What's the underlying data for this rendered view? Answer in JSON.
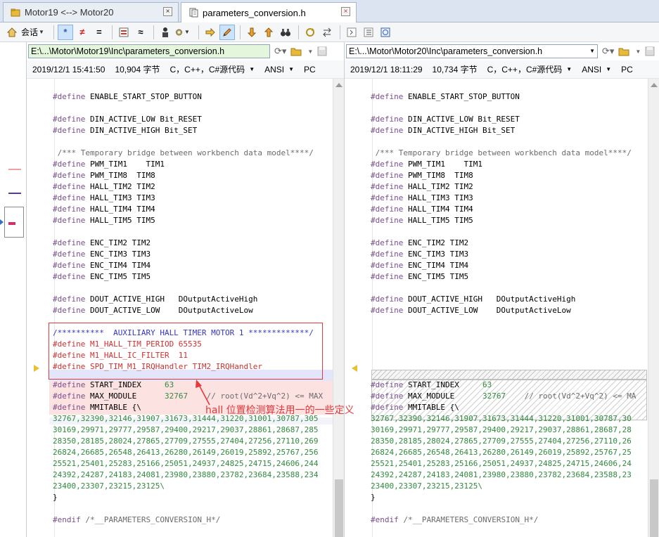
{
  "tabs": [
    {
      "label": "Motor19 <--> Motor20",
      "close": "×"
    },
    {
      "label": "parameters_conversion.h",
      "close": "×"
    }
  ],
  "toolbar": {
    "session_label": "会话"
  },
  "left": {
    "path": "E:\\...\\Motor\\Motor19\\Inc\\parameters_conversion.h",
    "date": "2019/12/1 15:41:50",
    "size": "10,904 字节",
    "lang": "C，C++，C#源代码",
    "encoding": "ANSI",
    "eol": "PC"
  },
  "right": {
    "path": "E:\\...\\Motor\\Motor20\\Inc\\parameters_conversion.h",
    "date": "2019/12/1 18:11:29",
    "size": "10,734 字节",
    "lang": "C，C++，C#源代码",
    "encoding": "ANSI",
    "eol": "PC"
  },
  "code_left": [
    {
      "kw": "#define",
      "rest": " ENABLE_START_STOP_BUTTON"
    },
    {
      "kw": "",
      "rest": ""
    },
    {
      "kw": "#define",
      "rest": " DIN_ACTIVE_LOW Bit_RESET"
    },
    {
      "kw": "#define",
      "rest": " DIN_ACTIVE_HIGH Bit_SET"
    },
    {
      "kw": "",
      "rest": ""
    },
    {
      "kw": "",
      "rest": "",
      "comment": " /*** Temporary bridge between workbench data model****/"
    },
    {
      "kw": "#define",
      "rest": " PWM_TIM1    TIM1"
    },
    {
      "kw": "#define",
      "rest": " PWM_TIM8  TIM8"
    },
    {
      "kw": "#define",
      "rest": " HALL_TIM2 TIM2"
    },
    {
      "kw": "#define",
      "rest": " HALL_TIM3 TIM3"
    },
    {
      "kw": "#define",
      "rest": " HALL_TIM4 TIM4"
    },
    {
      "kw": "#define",
      "rest": " HALL_TIM5 TIM5"
    },
    {
      "kw": "",
      "rest": ""
    },
    {
      "kw": "#define",
      "rest": " ENC_TIM2 TIM2"
    },
    {
      "kw": "#define",
      "rest": " ENC_TIM3 TIM3"
    },
    {
      "kw": "#define",
      "rest": " ENC_TIM4 TIM4"
    },
    {
      "kw": "#define",
      "rest": " ENC_TIM5 TIM5"
    },
    {
      "kw": "",
      "rest": ""
    },
    {
      "kw": "#define",
      "rest": " DOUT_ACTIVE_HIGH   DOutputActiveHigh"
    },
    {
      "kw": "#define",
      "rest": " DOUT_ACTIVE_LOW    DOutputActiveLow"
    },
    {
      "kw": "",
      "rest": ""
    }
  ],
  "diff_left": [
    "/**********  AUXILIARY HALL TIMER MOTOR 1 *************/",
    "#define M1_HALL_TIM_PERIOD 65535",
    "#define M1_HALL_IC_FILTER  11",
    "#define SPD_TIM_M1_IRQHandler TIM2_IRQHandler"
  ],
  "code_tail": {
    "start_index_kw": "#define",
    "start_index_name": " START_INDEX",
    "start_index_val": "63",
    "max_module_kw": "#define",
    "max_module_name": " MAX_MODULE",
    "max_module_val": "32767",
    "max_module_cm_left": "// root(Vd^2+Vq^2) <= MAX",
    "max_module_cm_right": "// root(Vd^2+Vq^2) <= MA",
    "mmitable_kw": "#define",
    "mmitable_rest": " MMITABLE {\\",
    "rows_left": [
      "32767,32390,32146,31907,31673,31444,31220,31001,30787,305",
      "30169,29971,29777,29587,29400,29217,29037,28861,28687,285",
      "28350,28185,28024,27865,27709,27555,27404,27256,27110,269",
      "26824,26685,26548,26413,26280,26149,26019,25892,25767,256",
      "25521,25401,25283,25166,25051,24937,24825,24715,24606,244",
      "24392,24287,24183,24081,23980,23880,23782,23684,23588,234",
      "23400,23307,23215,23125\\"
    ],
    "rows_right": [
      "32767,32390,32146,31907,31673,31444,31220,31001,30787,30",
      "30169,29971,29777,29587,29400,29217,29037,28861,28687,28",
      "28350,28185,28024,27865,27709,27555,27404,27256,27110,26",
      "26824,26685,26548,26413,26280,26149,26019,25892,25767,25",
      "25521,25401,25283,25166,25051,24937,24825,24715,24606,24",
      "24392,24287,24183,24081,23980,23880,23782,23684,23588,23",
      "23400,23307,23215,23125\\"
    ],
    "close_brace": "}",
    "endif_kw": "#endif",
    "endif_cm": " /*__PARAMETERS_CONVERSION_H*/"
  },
  "annotation": {
    "text": "hall 位置检测算法用一的一些定义",
    "color": "#e5383b"
  },
  "colors": {
    "diff_removed_bg": "#fde2e2",
    "diff_header_bg": "#e3e6fa",
    "keyword": "#7a4d8c",
    "number": "#2e8b3e"
  }
}
